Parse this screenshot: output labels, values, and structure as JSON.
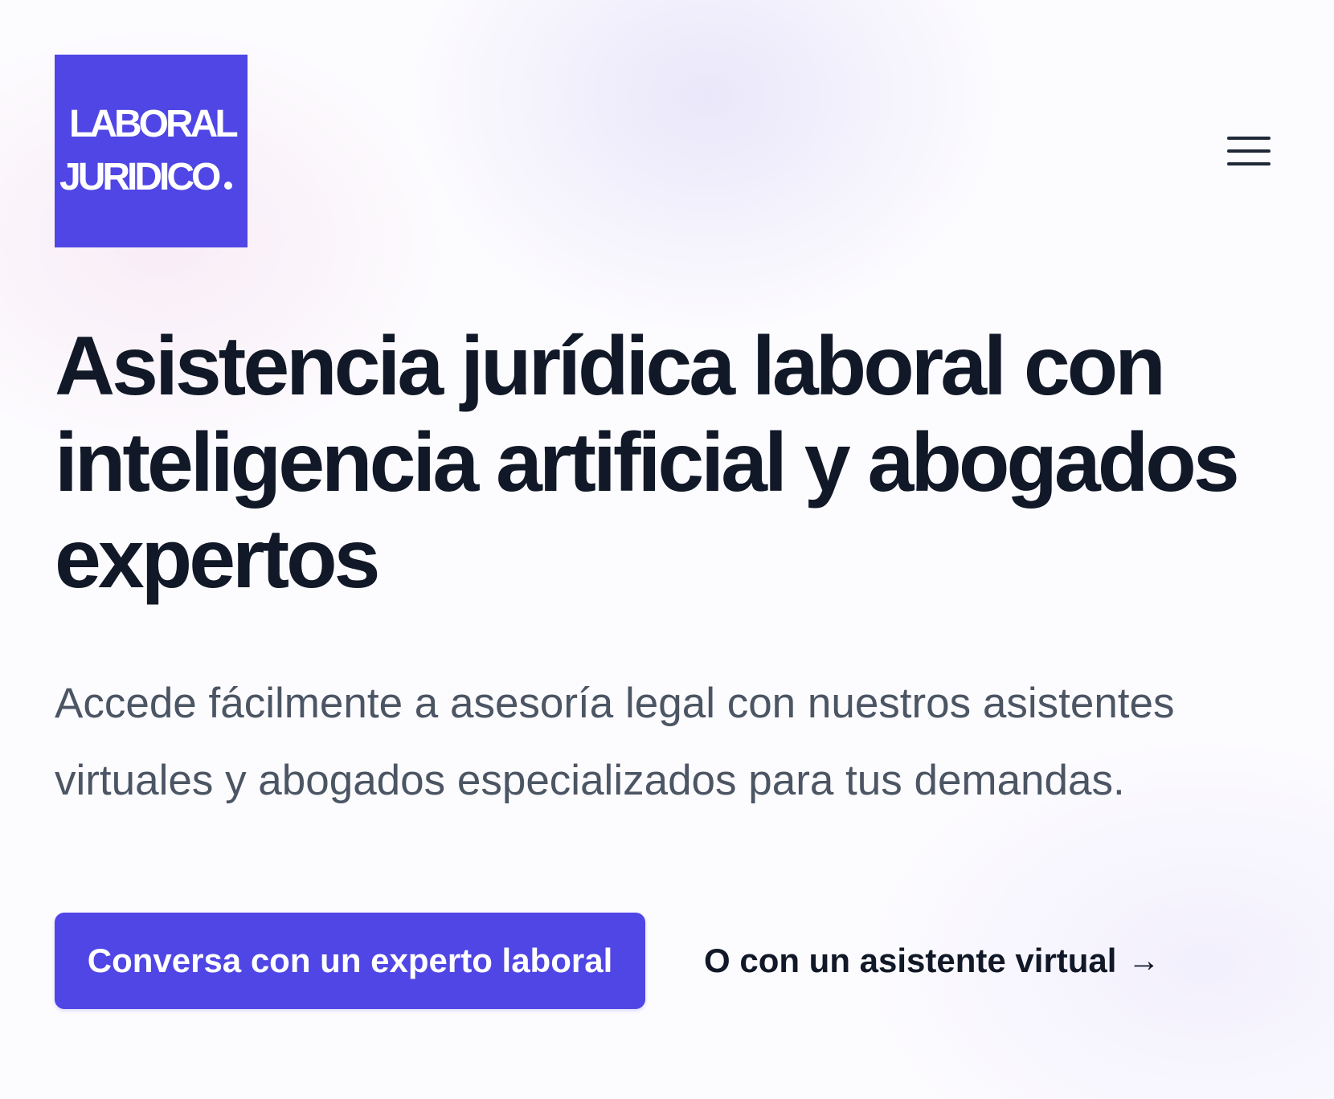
{
  "header": {
    "logo": {
      "line1": "LABORAL",
      "line2": "JURIDICO"
    },
    "menu_icon": "hamburger-menu-icon"
  },
  "hero": {
    "title": "Asistencia jurídica laboral con inteligencia artificial y abogados expertos",
    "subtitle": "Accede fácilmente a asesoría legal con nuestros asistentes virtuales y abogados especializados para tus demandas.",
    "primary_cta": "Conversa con un experto laboral",
    "secondary_cta": "O con un asistente virtual",
    "secondary_cta_icon": "arrow-right-icon"
  },
  "colors": {
    "accent": "#4f46e5",
    "heading": "#111827",
    "body_text": "#4b5563"
  }
}
